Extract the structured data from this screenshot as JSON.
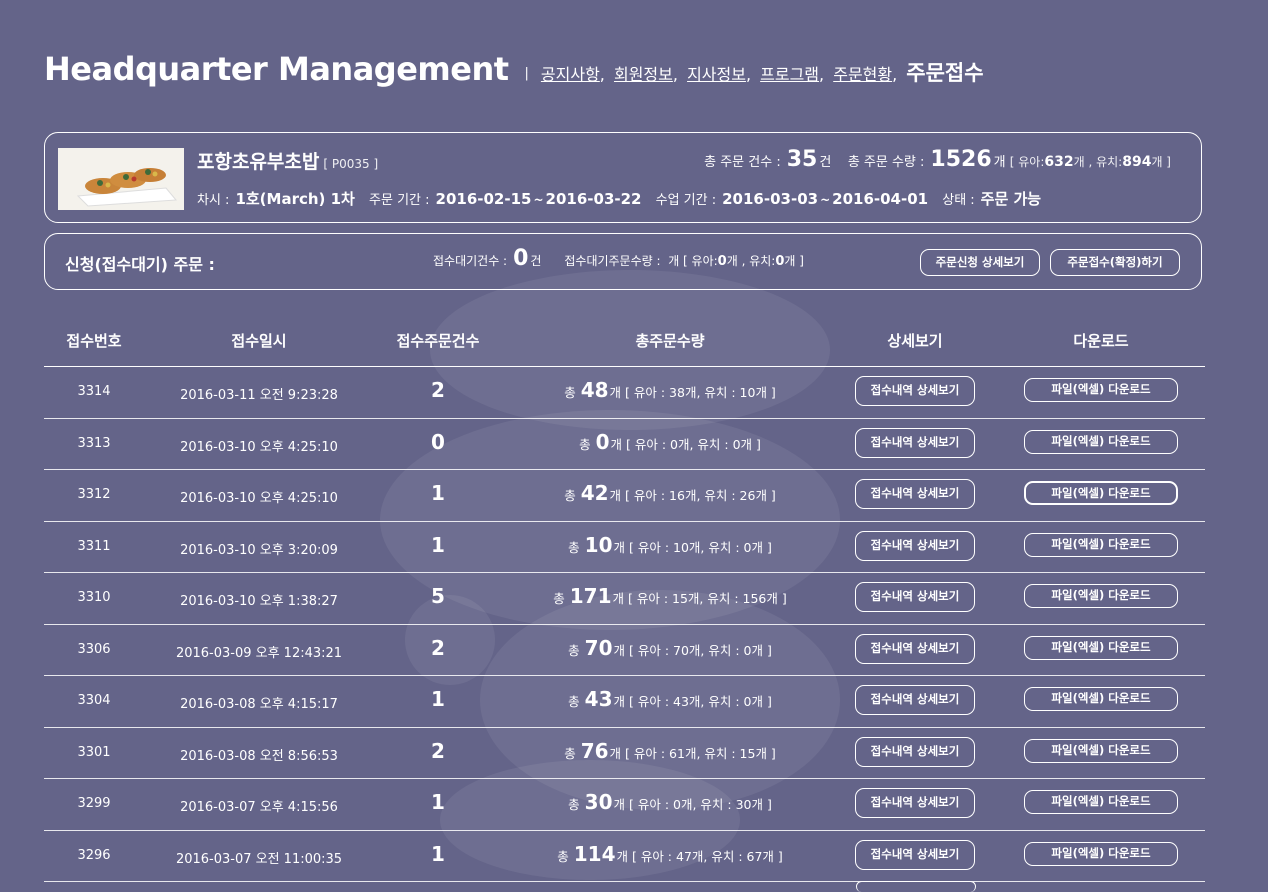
{
  "header": {
    "brand": "Headquarter Management",
    "separator": "|",
    "nav": [
      {
        "label": "공지사항"
      },
      {
        "label": "회원정보"
      },
      {
        "label": "지사정보"
      },
      {
        "label": "프로그램"
      },
      {
        "label": "주문현황"
      }
    ],
    "comma": ",",
    "current": "주문접수"
  },
  "product": {
    "name": "포항초유부초밥",
    "code": "[ P0035 ]",
    "total_orders_label": "총 주문 건수 :",
    "total_orders": "35",
    "unit_count": "건",
    "total_qty_label": "총 주문 수량 :",
    "total_qty": "1526",
    "unit_qty": "개",
    "breakdown_prefix": "[ 유아:",
    "infant_qty": "632",
    "breakdown_mid": "개 , 유치:",
    "kinder_qty": "894",
    "breakdown_suffix": "개 ]",
    "round_label": "차시 :",
    "round_value": "1호(March) 1차",
    "order_period_label": "주문 기간 :",
    "order_start": "2016-02-15",
    "order_end": "2016-03-22",
    "tilde": "~",
    "class_period_label": "수업 기간 :",
    "class_start": "2016-03-03",
    "class_end": "2016-04-01",
    "status_label": "상태 :",
    "status_value": "주문 가능"
  },
  "pending": {
    "title": "신청(접수대기) 주문 :",
    "count_label": "접수대기건수 :",
    "count": "0",
    "count_unit": "건",
    "qty_label": "접수대기주문수량 :",
    "qty_prefix": "개 [ 유아:",
    "infant": "0",
    "qty_mid": "개 , 유치:",
    "kinder": "0",
    "qty_suffix": "개 ]",
    "detail_button": "주문신청 상세보기",
    "confirm_button": "주문접수(확정)하기"
  },
  "table": {
    "headers": [
      "접수번호",
      "접수일시",
      "접수주문건수",
      "총주문수량",
      "상세보기",
      "다운로드"
    ],
    "qty_prefix": "총",
    "qty_unit": "개",
    "detail_button": "접수내역 상세보기",
    "download_button": "파일(엑셀) 다운로드",
    "rows": [
      {
        "no": "3314",
        "datetime": "2016-03-11 오전 9:23:28",
        "count": "2",
        "total": "48",
        "breakdown": "[ 유아 : 38개, 유치 : 10개 ]"
      },
      {
        "no": "3313",
        "datetime": "2016-03-10 오후 4:25:10",
        "count": "0",
        "total": "0",
        "breakdown": "[ 유아 : 0개, 유치 : 0개 ]"
      },
      {
        "no": "3312",
        "datetime": "2016-03-10 오후 4:25:10",
        "count": "1",
        "total": "42",
        "breakdown": "[ 유아 : 16개, 유치 : 26개 ]"
      },
      {
        "no": "3311",
        "datetime": "2016-03-10 오후 3:20:09",
        "count": "1",
        "total": "10",
        "breakdown": "[ 유아 : 10개, 유치 : 0개 ]"
      },
      {
        "no": "3310",
        "datetime": "2016-03-10 오후 1:38:27",
        "count": "5",
        "total": "171",
        "breakdown": "[ 유아 : 15개, 유치 : 156개 ]"
      },
      {
        "no": "3306",
        "datetime": "2016-03-09 오후 12:43:21",
        "count": "2",
        "total": "70",
        "breakdown": "[ 유아 : 70개, 유치 : 0개 ]"
      },
      {
        "no": "3304",
        "datetime": "2016-03-08 오후 4:15:17",
        "count": "1",
        "total": "43",
        "breakdown": "[ 유아 : 43개, 유치 : 0개 ]"
      },
      {
        "no": "3301",
        "datetime": "2016-03-08 오전 8:56:53",
        "count": "2",
        "total": "76",
        "breakdown": "[ 유아 : 61개, 유치 : 15개 ]"
      },
      {
        "no": "3299",
        "datetime": "2016-03-07 오후 4:15:56",
        "count": "1",
        "total": "30",
        "breakdown": "[ 유아 : 0개, 유치 : 30개 ]"
      },
      {
        "no": "3296",
        "datetime": "2016-03-07 오전 11:00:35",
        "count": "1",
        "total": "114",
        "breakdown": "[ 유아 : 47개, 유치 : 67개 ]"
      }
    ]
  },
  "colors": {
    "background": "#646489",
    "text": "#ffffff"
  }
}
